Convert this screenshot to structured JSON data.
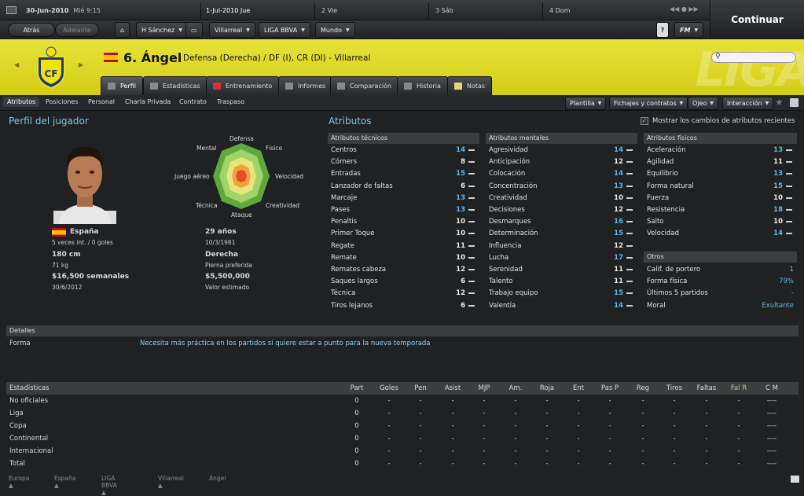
{
  "topbar": {
    "date": "30-Jun-2010",
    "weekday": "Mié 9:15",
    "days": [
      "1-Jul-2010 Jue",
      "2 Vie",
      "3 Sáb",
      "4 Dom"
    ],
    "continue": "Continuar"
  },
  "nav": {
    "back": "Atrás",
    "forward": "Adelante",
    "manager": "H Sánchez",
    "club": "Villarreal",
    "league": "LIGA BBVA",
    "world": "Mundo",
    "help": "?",
    "fm": "FM"
  },
  "player": {
    "number_name": "6. Ángel",
    "position": "Defensa (Derecha) / DF (I), CR (DI) - Villarreal",
    "nationality": "España",
    "caps": "5 veces int. / 0 goles",
    "height": "180 cm",
    "weight": "71 kg",
    "wage": "$16,500 semanales",
    "contract": "30/6/2012",
    "age": "29 años",
    "dob": "10/3/1981",
    "foot": "Derecha",
    "foot_label": "Pierna preferida",
    "value": "$5,500,000",
    "value_label": "Valor estimado"
  },
  "tabs": [
    "Perfil",
    "Estadísticas",
    "Entrenamiento",
    "Informes",
    "Comparación",
    "Historia",
    "Notas"
  ],
  "subtabs": [
    "Atributos",
    "Posiciones",
    "Personal",
    "Charla Privada",
    "Contrato",
    "Traspaso"
  ],
  "actions": [
    "Plantilla",
    "Fichajes y contratos",
    "Ojeo",
    "Interacción"
  ],
  "profile_title": "Perfil del jugador",
  "radar": {
    "labels": [
      "Defensa",
      "Físico",
      "Velocidad",
      "Creatividad",
      "Ataque",
      "Técnica",
      "Juego aéreo",
      "Mental"
    ]
  },
  "attr_title": "Atributos",
  "show_changes": "Mostrar los cambios de atributos recientes",
  "technical": {
    "title": "Atributos técnicos",
    "rows": [
      [
        "Centros",
        "14"
      ],
      [
        "Córners",
        "8"
      ],
      [
        "Entradas",
        "15"
      ],
      [
        "Lanzador de faltas",
        "6"
      ],
      [
        "Marcaje",
        "13"
      ],
      [
        "Pases",
        "13"
      ],
      [
        "Penaltis",
        "10"
      ],
      [
        "Primer Toque",
        "10"
      ],
      [
        "Regate",
        "11"
      ],
      [
        "Remate",
        "10"
      ],
      [
        "Remates cabeza",
        "12"
      ],
      [
        "Saques largos",
        "6"
      ],
      [
        "Técnica",
        "12"
      ],
      [
        "Tiros lejanos",
        "6"
      ]
    ]
  },
  "mental": {
    "title": "Atributos mentales",
    "rows": [
      [
        "Agresividad",
        "14"
      ],
      [
        "Anticipación",
        "12"
      ],
      [
        "Colocación",
        "14"
      ],
      [
        "Concentración",
        "13"
      ],
      [
        "Creatividad",
        "10"
      ],
      [
        "Decisiones",
        "12"
      ],
      [
        "Desmarques",
        "16"
      ],
      [
        "Determinación",
        "15"
      ],
      [
        "Influencia",
        "12"
      ],
      [
        "Lucha",
        "17"
      ],
      [
        "Serenidad",
        "11"
      ],
      [
        "Talento",
        "11"
      ],
      [
        "Trabajo equipo",
        "15"
      ],
      [
        "Valentía",
        "14"
      ]
    ]
  },
  "physical": {
    "title": "Atributos físicos",
    "rows": [
      [
        "Aceleración",
        "13"
      ],
      [
        "Agilidad",
        "11"
      ],
      [
        "Equilibrio",
        "13"
      ],
      [
        "Forma natural",
        "15"
      ],
      [
        "Fuerza",
        "10"
      ],
      [
        "Resistencia",
        "18"
      ],
      [
        "Salto",
        "10"
      ],
      [
        "Velocidad",
        "14"
      ]
    ]
  },
  "others": {
    "title": "Otros",
    "rows": [
      [
        "Calif. de portero",
        "1"
      ],
      [
        "Forma física",
        "79%"
      ],
      [
        "Últimos 5 partidos",
        "-"
      ],
      [
        "Moral",
        "Exultante"
      ]
    ]
  },
  "details": {
    "title": "Detalles",
    "label": "Forma",
    "text": "Necesita más práctica en los partidos si quiere estar a punto para la nueva temporada"
  },
  "stats": {
    "headers": [
      "Estadísticas",
      "Part",
      "Goles",
      "Pen",
      "Asist",
      "MJP",
      "Am.",
      "Roja",
      "Ent",
      "Pas P",
      "Reg",
      "Tiros",
      "Faltas",
      "Fal R",
      "C M"
    ],
    "rows": [
      [
        "No oficiales",
        "0",
        "-",
        "-",
        "-",
        "-",
        "-",
        "-",
        "-",
        "-",
        "-",
        "-",
        "-",
        "-",
        "----"
      ],
      [
        "Liga",
        "0",
        "-",
        "-",
        "-",
        "-",
        "-",
        "-",
        "-",
        "-",
        "-",
        "-",
        "-",
        "-",
        "----"
      ],
      [
        "Copa",
        "0",
        "-",
        "-",
        "-",
        "-",
        "-",
        "-",
        "-",
        "-",
        "-",
        "-",
        "-",
        "-",
        "----"
      ],
      [
        "Continental",
        "0",
        "-",
        "-",
        "-",
        "-",
        "-",
        "-",
        "-",
        "-",
        "-",
        "-",
        "-",
        "-",
        "----"
      ],
      [
        "Internacional",
        "0",
        "-",
        "-",
        "-",
        "-",
        "-",
        "-",
        "-",
        "-",
        "-",
        "-",
        "-",
        "-",
        "----"
      ],
      [
        "Total",
        "0",
        "-",
        "-",
        "-",
        "-",
        "-",
        "-",
        "-",
        "-",
        "-",
        "-",
        "-",
        "-",
        "----"
      ]
    ]
  },
  "breadcrumb": [
    "Europa",
    "España",
    "LIGA BBVA",
    "Villarreal",
    "Ángel"
  ],
  "colors": {
    "header": "#e3dc2a",
    "accent": "#7ec4e8",
    "value_blue": "#57b7ee"
  }
}
